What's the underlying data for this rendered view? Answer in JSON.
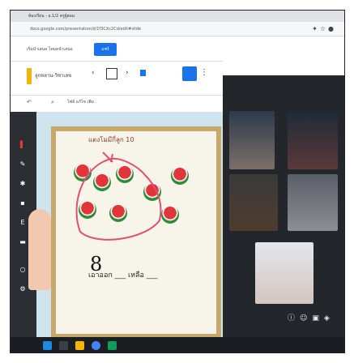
{
  "browser": {
    "tab_text": "ห้องเรียน - อ.1/2 ครูผู้สอน",
    "url": "docs.google.com/presentation/d/1f3CXc2Cd/edit#slide",
    "icons": [
      "extension-icon",
      "star-icon",
      "profile-icon"
    ]
  },
  "share_bar": {
    "text": "เริ่มนำเสนอ โหมดนำเสนอ",
    "button_label": "แชร์"
  },
  "doc": {
    "title": "ลูกหลาน-วิชาเลข",
    "menu": "ไฟล์ แก้ไข เพิ่ม"
  },
  "slide": {
    "title": "แตงโมมีกี่ลูก 10",
    "number": "8",
    "equation": "เอาออก ___ เหลือ ___"
  },
  "taskbar": {
    "icons": [
      "start-icon",
      "search-icon",
      "files-icon",
      "chrome-icon",
      "meet-icon"
    ]
  },
  "colors": {
    "accent": "#1a73e8",
    "meet_bg": "#23272b",
    "slide_frame": "#c9a86b"
  }
}
